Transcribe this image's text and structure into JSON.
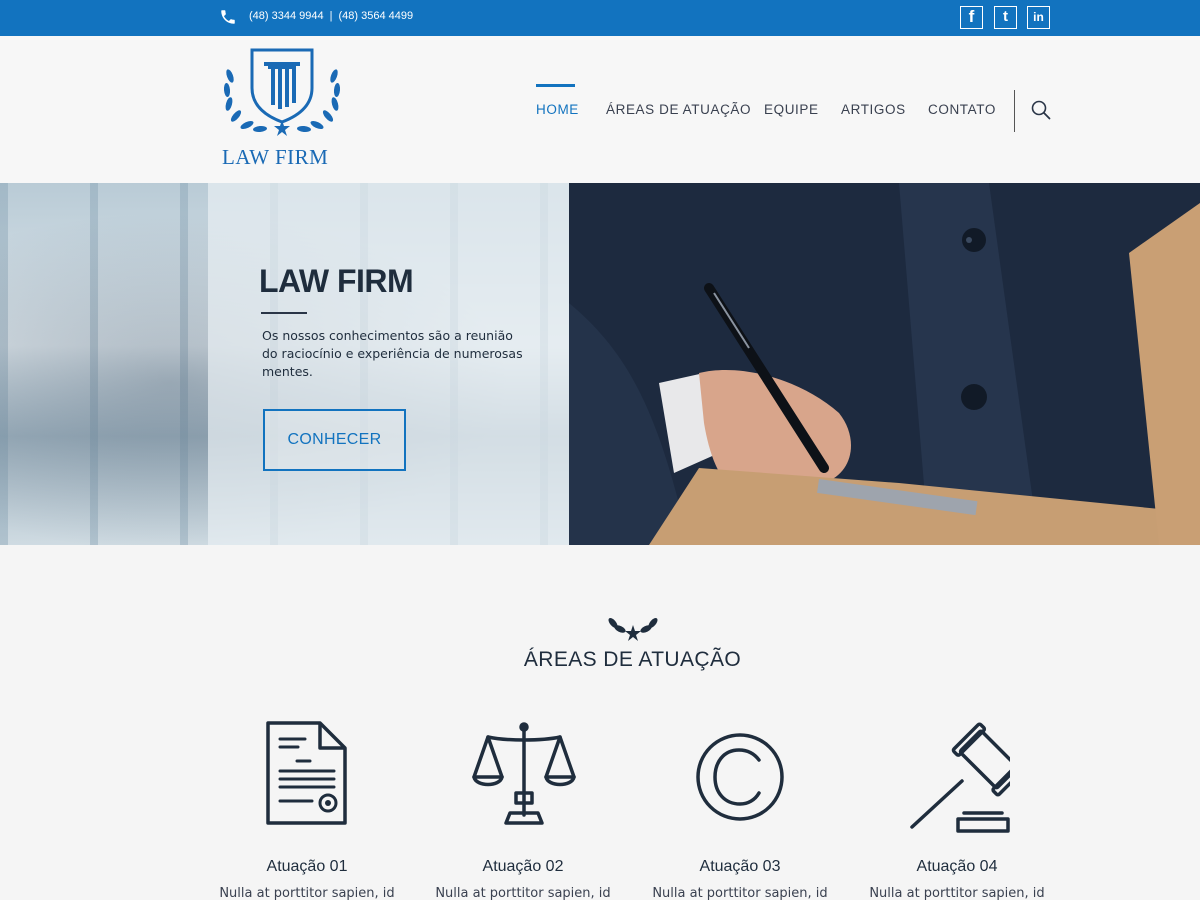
{
  "topbar": {
    "phone1": "(48) 3344 9944",
    "separator": "|",
    "phone2": "(48) 3564 4499",
    "social": [
      {
        "icon": "facebook-icon",
        "glyph": "f"
      },
      {
        "icon": "twitter-icon",
        "glyph": "t"
      },
      {
        "icon": "linkedin-icon",
        "glyph": "in"
      }
    ]
  },
  "header": {
    "logo_text": "LAW FIRM",
    "nav": [
      "HOME",
      "ÁREAS DE ATUAÇÃO",
      "EQUIPE",
      "ARTIGOS",
      "CONTATO"
    ],
    "active_nav": "HOME"
  },
  "hero": {
    "title": "LAW FIRM",
    "text": "Os nossos conhecimentos são a reunião do raciocínio e experiência de numerosas mentes.",
    "button": "CONHECER"
  },
  "areas": {
    "title": "ÁREAS DE ATUAÇÃO",
    "items": [
      {
        "name": "Atuação 01",
        "desc": "Nulla at porttitor sapien, id",
        "icon": "document-icon"
      },
      {
        "name": "Atuação 02",
        "desc": "Nulla at porttitor sapien, id",
        "icon": "scales-icon"
      },
      {
        "name": "Atuação 03",
        "desc": "Nulla at porttitor sapien, id",
        "icon": "copyright-icon"
      },
      {
        "name": "Atuação 04",
        "desc": "Nulla at porttitor sapien, id",
        "icon": "gavel-icon"
      }
    ]
  },
  "colors": {
    "brand_blue": "#1273bf",
    "dark_navy": "#1f2d3d"
  }
}
